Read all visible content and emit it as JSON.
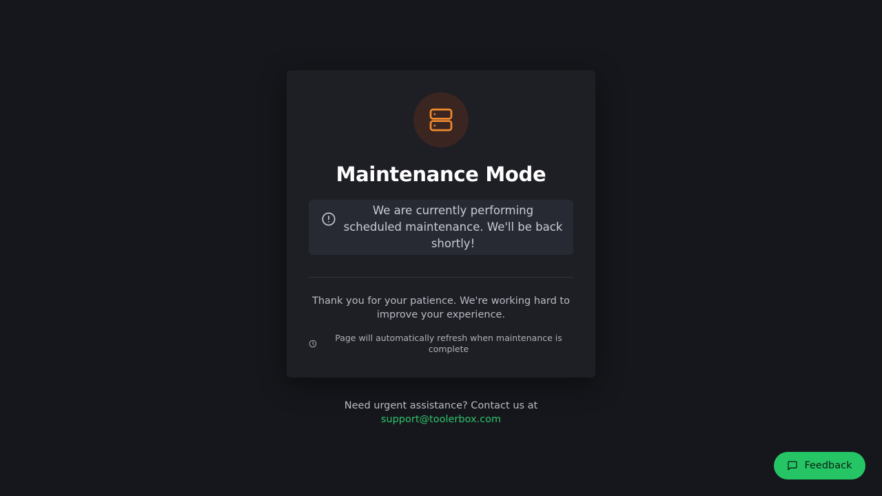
{
  "card": {
    "icon": "server-icon",
    "title": "Maintenance Mode",
    "alert": {
      "icon": "alert-circle-icon",
      "text": "We are currently performing scheduled maintenance. We'll be back shortly!"
    },
    "thanks": "Thank you for your patience. We're working hard to improve your experience.",
    "refresh": {
      "icon": "clock-icon",
      "text": "Page will automatically refresh when maintenance is complete"
    }
  },
  "contact": {
    "prefix": "Need urgent assistance? Contact us at",
    "email": "support@toolerbox.com"
  },
  "feedback": {
    "icon": "message-square-icon",
    "label": "Feedback"
  },
  "colors": {
    "background": "#16171c",
    "card": "#1e1f25",
    "accent_orange": "#f28a30",
    "accent_green": "#25c565"
  }
}
